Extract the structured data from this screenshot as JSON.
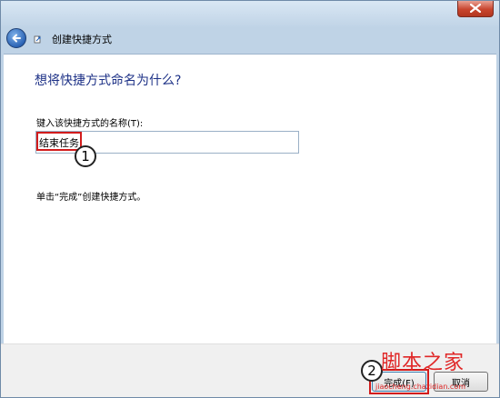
{
  "wizard": {
    "title": "创建快捷方式"
  },
  "content": {
    "heading": "想将快捷方式命名为什么?",
    "name_label": "键入该快捷方式的名称(T):",
    "name_value": "结束任务",
    "instruction": "单击“完成”创建快捷方式。"
  },
  "footer": {
    "finish_label": "完成(F)",
    "cancel_label": "取消"
  },
  "annotations": {
    "marker1": "1",
    "marker2": "2"
  },
  "watermark": {
    "text": "脚本之家",
    "url": "jiaocheng.chazidian.com"
  },
  "colors": {
    "heading": "#1e3287",
    "highlight": "#d21c1c",
    "watermark": "#e02727"
  }
}
